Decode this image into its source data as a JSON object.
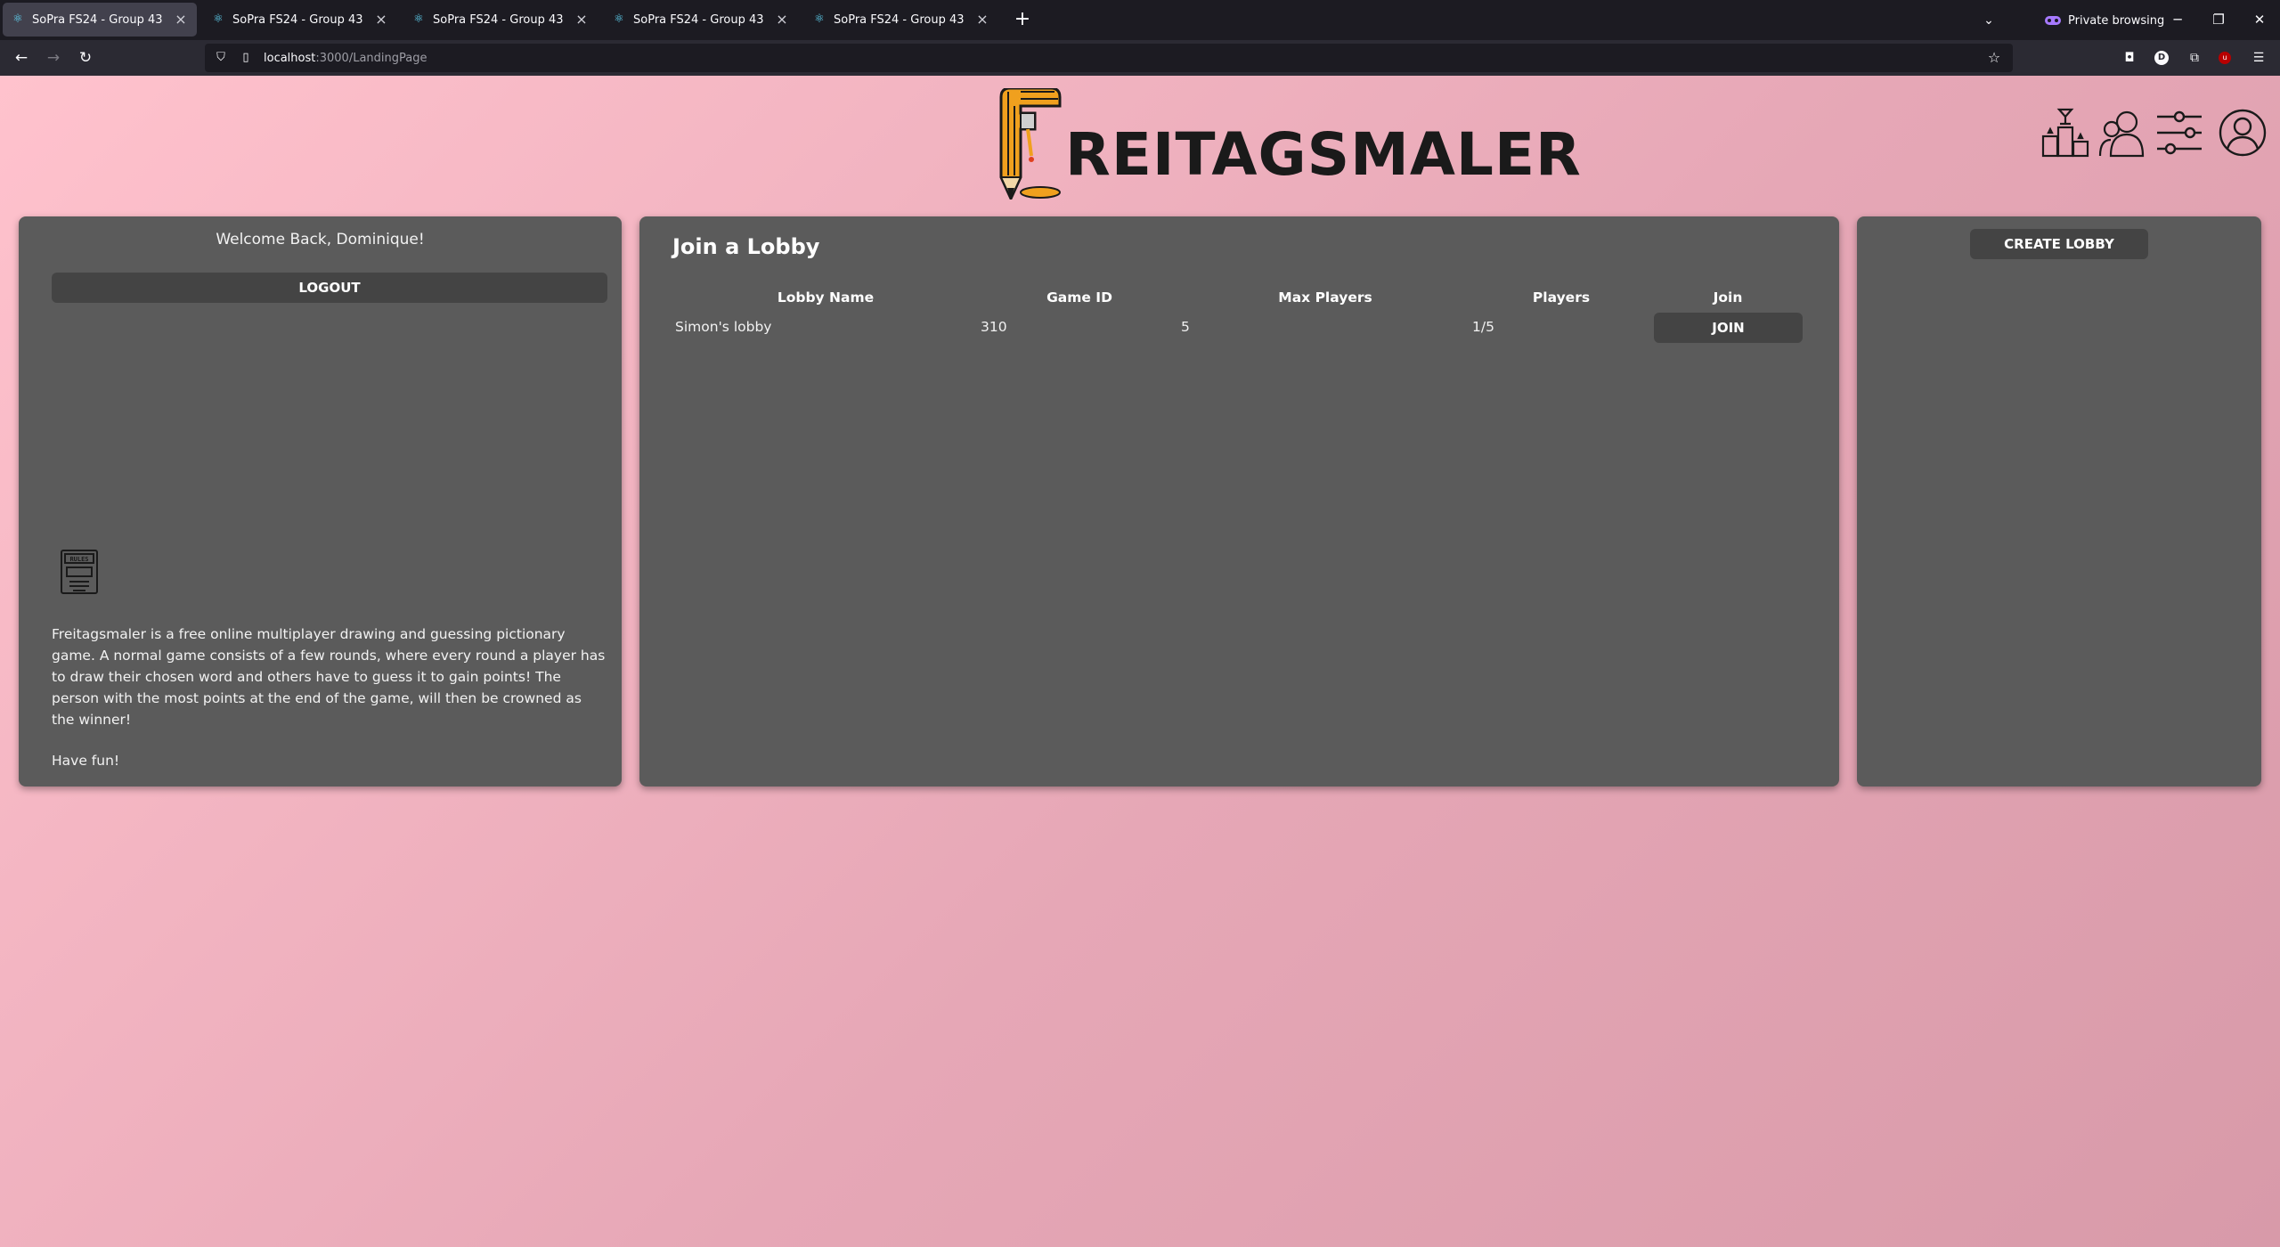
{
  "browser": {
    "tabs": [
      {
        "title": "SoPra FS24 - Group 43",
        "active": true
      },
      {
        "title": "SoPra FS24 - Group 43",
        "active": false
      },
      {
        "title": "SoPra FS24 - Group 43",
        "active": false
      },
      {
        "title": "SoPra FS24 - Group 43",
        "active": false
      },
      {
        "title": "SoPra FS24 - Group 43",
        "active": false
      }
    ],
    "private_label": "Private browsing",
    "url_host": "localhost",
    "url_path": ":3000/LandingPage"
  },
  "header": {
    "logo_text": "REITAGSMALER",
    "icons": [
      "leaderboard-icon",
      "friends-icon",
      "settings-icon",
      "profile-icon"
    ]
  },
  "left": {
    "welcome": "Welcome Back, Dominique!",
    "logout_label": "LOGOUT",
    "description": "Freitagsmaler is a free online multiplayer drawing and guessing pictionary game. A normal game consists of a few rounds, where every round a player has to draw their chosen word and others have to guess it to gain points! The person with the most points at the end of the game, will then be crowned as the winner!",
    "have_fun": "Have fun!"
  },
  "lobbies": {
    "title": "Join a Lobby",
    "columns": [
      "Lobby Name",
      "Game ID",
      "Max Players",
      "Players",
      "Join"
    ],
    "rows": [
      {
        "name": "Simon's lobby",
        "game_id": "310",
        "max_players": "5",
        "players": "1/5",
        "join_label": "JOIN"
      }
    ]
  },
  "right": {
    "create_label": "CREATE LOBBY"
  },
  "colors": {
    "panel": "#5b5b5b",
    "button": "#444444",
    "bg_start": "#ffc2cd",
    "bg_end": "#d89aa9",
    "logo_pencil": "#f0a01e"
  }
}
